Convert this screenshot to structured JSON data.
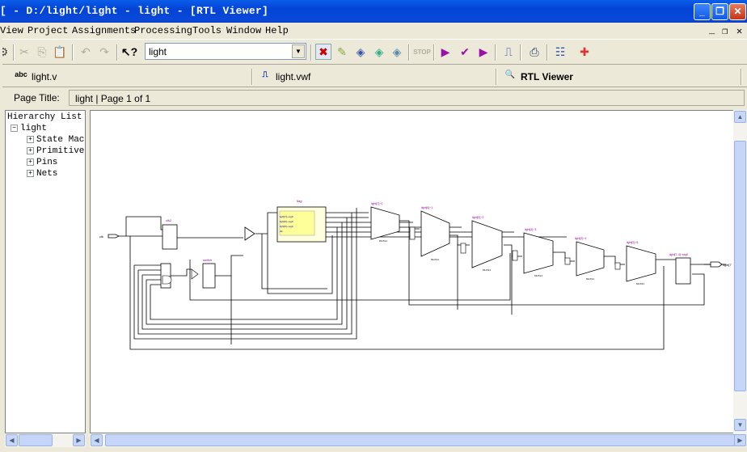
{
  "window": {
    "title": "[ - D:/light/light - light - [RTL Viewer]",
    "controls": {
      "minimize": "_",
      "restore": "❐",
      "close": "✕"
    }
  },
  "menu": {
    "items": [
      "View",
      "Project",
      "Assignments",
      "Processing",
      "Tools",
      "Window",
      "Help"
    ],
    "mdi": {
      "minimize": "_",
      "restore": "❐",
      "close": "✕"
    }
  },
  "toolbar": {
    "combo_value": "light"
  },
  "tabs": [
    {
      "label": "light.v",
      "icon": "verilog-file-icon"
    },
    {
      "label": "light.vwf",
      "icon": "waveform-file-icon"
    },
    {
      "label": "RTL Viewer",
      "icon": "rtl-viewer-icon",
      "active": true
    }
  ],
  "page": {
    "label": "Page Title:",
    "value": "light | Page 1 of 1"
  },
  "hierarchy": {
    "title": "Hierarchy List",
    "root": "light",
    "children": [
      "State Mac",
      "Primitive:",
      "Pins",
      "Nets"
    ]
  },
  "schematic": {
    "input_pin": "clk",
    "output_pin": "light[7",
    "clkdiv": "clk2",
    "switch": "switch",
    "fsm": "flag",
    "fsm_ports": [
      "light[7]~reg0",
      "light[6]~reg0",
      "light[5]~reg0",
      "clk"
    ],
    "mux_label": "MUX21",
    "mux_titles": [
      "light[7]~0",
      "light[6]~1",
      "light[5]~2",
      "light[4]~3",
      "light[3]~4",
      "light[2]~5"
    ],
    "out_reg": "light[7..0]~reg0"
  }
}
